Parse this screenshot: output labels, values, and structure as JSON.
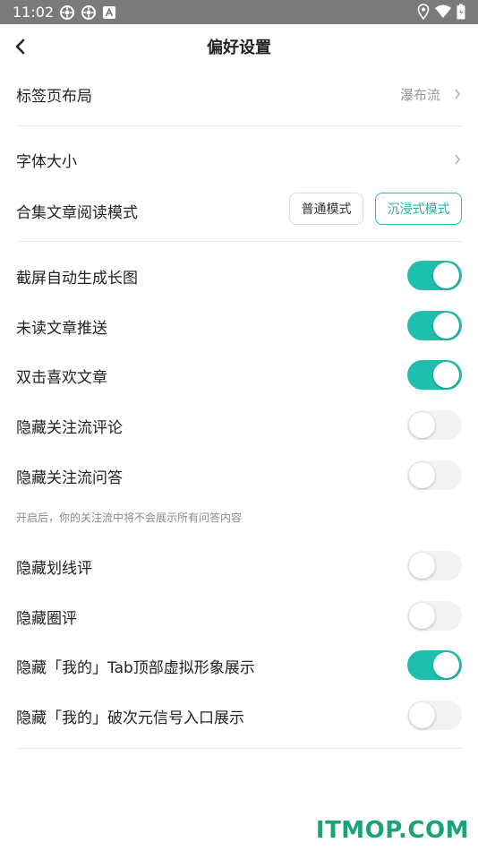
{
  "status_bar": {
    "time": "11:02"
  },
  "header": {
    "title": "偏好设置"
  },
  "settings": {
    "tab_layout": {
      "label": "标签页布局",
      "value": "瀑布流"
    },
    "font_size": {
      "label": "字体大小"
    },
    "collection_read_mode": {
      "label": "合集文章阅读模式",
      "options": [
        "普通模式",
        "沉浸式模式"
      ],
      "selected": "沉浸式模式"
    },
    "toggles": [
      {
        "label": "截屏自动生成长图",
        "on": true
      },
      {
        "label": "未读文章推送",
        "on": true
      },
      {
        "label": "双击喜欢文章",
        "on": true
      },
      {
        "label": "隐藏关注流评论",
        "on": false
      },
      {
        "label": "隐藏关注流问答",
        "on": false
      },
      {
        "label": "隐藏划线评",
        "on": false
      },
      {
        "label": "隐藏圈评",
        "on": false
      },
      {
        "label": "隐藏「我的」Tab顶部虚拟形象展示",
        "on": true
      },
      {
        "label": "隐藏「我的」破次元信号入口展示",
        "on": false
      }
    ],
    "hide_qa_hint": "开启后，你的关注流中将不会展示所有问答内容"
  },
  "colors": {
    "accent": "#1fbfae",
    "toggle_off": "#f2f2f2",
    "status_bar": "#7a7a7a"
  },
  "watermark": "ITMOP.COM"
}
